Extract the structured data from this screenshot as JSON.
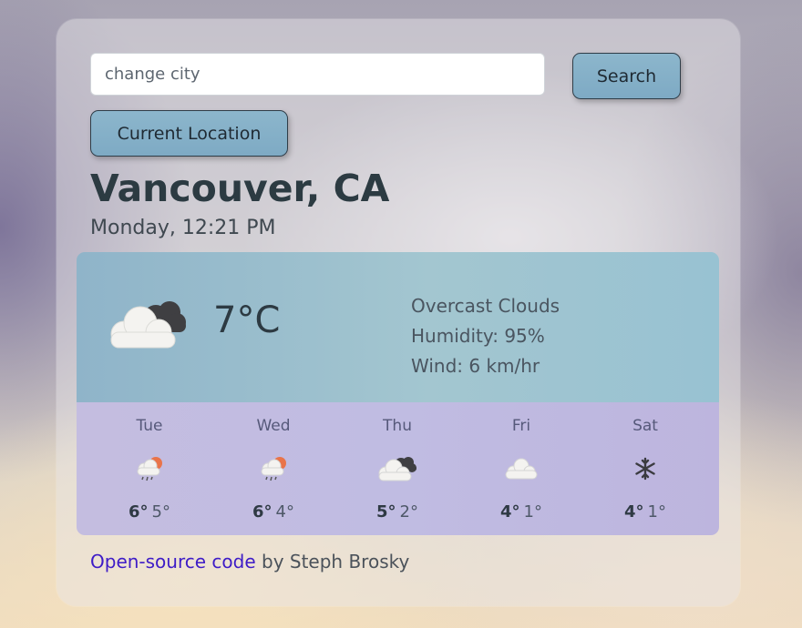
{
  "search": {
    "placeholder": "change city",
    "value": "",
    "button_label": "Search"
  },
  "location_button_label": "Current Location",
  "city": "Vancouver, CA",
  "datetime": "Monday, 12:21 PM",
  "current": {
    "icon": "overcast-clouds-icon",
    "temperature": "7",
    "unit": "°C",
    "description": "Overcast Clouds",
    "humidity": "Humidity: 95%",
    "wind": "Wind: 6 km/hr"
  },
  "forecast": [
    {
      "day": "Tue",
      "icon": "sun-rain-cloud-icon",
      "high": "6°",
      "low": "5°"
    },
    {
      "day": "Wed",
      "icon": "sun-rain-cloud-icon",
      "high": "6°",
      "low": "4°"
    },
    {
      "day": "Thu",
      "icon": "dark-clouds-icon",
      "high": "5°",
      "low": "2°"
    },
    {
      "day": "Fri",
      "icon": "cloud-icon",
      "high": "4°",
      "low": "1°"
    },
    {
      "day": "Sat",
      "icon": "snowflake-icon",
      "high": "4°",
      "low": "1°"
    }
  ],
  "footer": {
    "link_text": "Open-source code",
    "suffix": " by Steph Brosky"
  },
  "colors": {
    "current_panel": "#98bccc",
    "forecast_panel": "#c1bbe0",
    "button": "#85b0c8",
    "link": "#3e1cc7"
  }
}
